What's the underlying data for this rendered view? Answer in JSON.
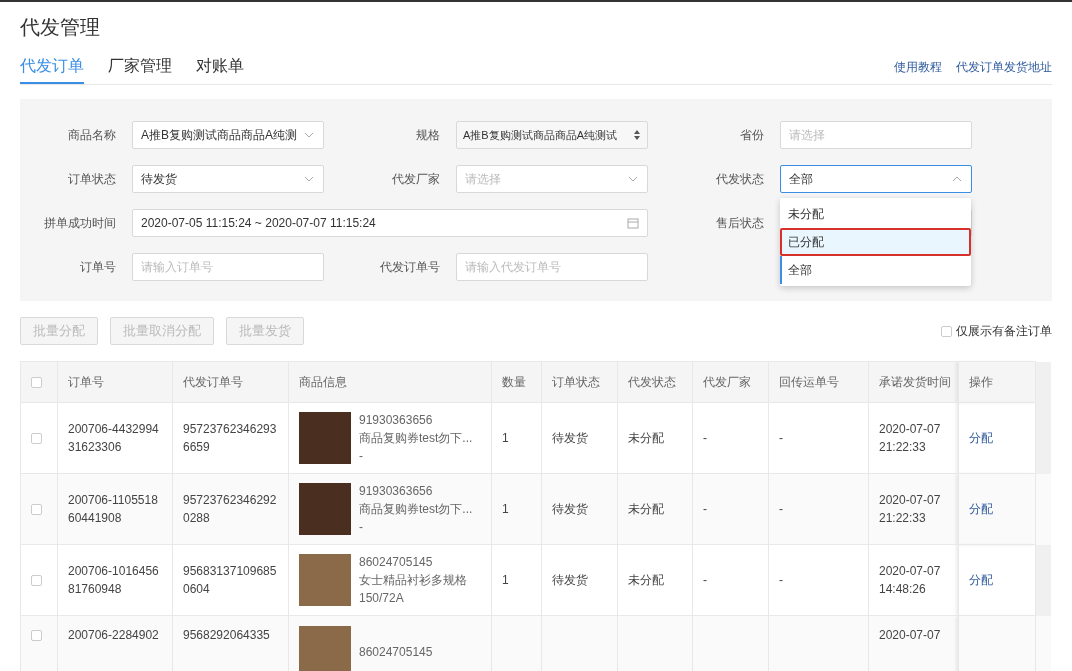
{
  "page_title": "代发管理",
  "tabs": [
    {
      "label": "代发订单",
      "selected": true
    },
    {
      "label": "厂家管理",
      "selected": false
    },
    {
      "label": "对账单",
      "selected": false
    }
  ],
  "header_links": [
    "使用教程",
    "代发订单发货地址"
  ],
  "filter_rows": [
    [
      {
        "label": "商品名称",
        "kind": "select",
        "value": "A推B复购测试商品商品A纯测",
        "open": false
      },
      {
        "label": "规格",
        "kind": "spinner",
        "value": "A推B复购测试商品商品A纯测试",
        "open": false
      },
      {
        "label": "省份",
        "kind": "input",
        "placeholder": "请选择",
        "open": false
      }
    ],
    [
      {
        "label": "订单状态",
        "kind": "select",
        "value": "待发货",
        "open": false
      },
      {
        "label": "代发厂家",
        "kind": "select",
        "placeholder": "请选择",
        "open": false
      },
      {
        "label": "代发状态",
        "kind": "select",
        "value": "全部",
        "open": true,
        "options": [
          {
            "label": "未分配",
            "highlighted": false,
            "selected": false
          },
          {
            "label": "已分配",
            "highlighted": true,
            "selected": false
          },
          {
            "label": "全部",
            "highlighted": false,
            "selected": true
          }
        ]
      }
    ],
    [
      {
        "label": "拼单成功时间",
        "kind": "daterange",
        "value": "2020-07-05 11:15:24 ~ 2020-07-07 11:15:24",
        "open": false
      },
      {
        "label": "售后状态",
        "kind": "select",
        "open": false
      }
    ],
    [
      {
        "label": "订单号",
        "kind": "input",
        "placeholder": "请输入订单号",
        "open": false
      },
      {
        "label": "代发订单号",
        "kind": "input",
        "placeholder": "请输入代发订单号",
        "open": false
      }
    ]
  ],
  "batch_buttons": [
    {
      "label": "批量分配",
      "disabled": true
    },
    {
      "label": "批量取消分配",
      "disabled": true
    },
    {
      "label": "批量发货",
      "disabled": true
    }
  ],
  "remark_filter": {
    "label": "仅展示有备注订单",
    "checked": false
  },
  "table": {
    "all_checked": false,
    "columns": [
      "订单号",
      "代发订单号",
      "商品信息",
      "数量",
      "订单状态",
      "代发状态",
      "代发厂家",
      "回传运单号",
      "承诺发货时间",
      "操作"
    ],
    "rows": [
      {
        "checked": false,
        "order_no": "200706-443299431623306",
        "daifa_no": "957237623462936659",
        "product_id": "91930363656",
        "product_name": "商品复购券test勿下...",
        "spec": "-",
        "qty": "1",
        "order_status": "待发货",
        "daifa_status": "未分配",
        "factory": "-",
        "tracking": "-",
        "ship_date": "2020-07-07",
        "ship_time": "21:22:33",
        "action": "分配"
      },
      {
        "checked": false,
        "order_no": "200706-110551860441908",
        "daifa_no": "957237623462920288",
        "product_id": "91930363656",
        "product_name": "商品复购券test勿下...",
        "spec": "-",
        "qty": "1",
        "order_status": "待发货",
        "daifa_status": "未分配",
        "factory": "-",
        "tracking": "-",
        "ship_date": "2020-07-07",
        "ship_time": "21:22:33",
        "action": "分配"
      },
      {
        "checked": false,
        "order_no": "200706-101645681760948",
        "daifa_no": "956831371096850604",
        "product_id": "86024705145",
        "product_name": "女士精品衬衫多规格",
        "spec": "150/72A",
        "qty": "1",
        "order_status": "待发货",
        "daifa_status": "未分配",
        "factory": "-",
        "tracking": "-",
        "ship_date": "2020-07-07",
        "ship_time": "14:48:26",
        "action": "分配"
      },
      {
        "checked": false,
        "order_no": "200706-2284902",
        "daifa_no": "9568292064335",
        "product_id": "86024705145",
        "ship_date": "2020-07-07"
      }
    ]
  }
}
